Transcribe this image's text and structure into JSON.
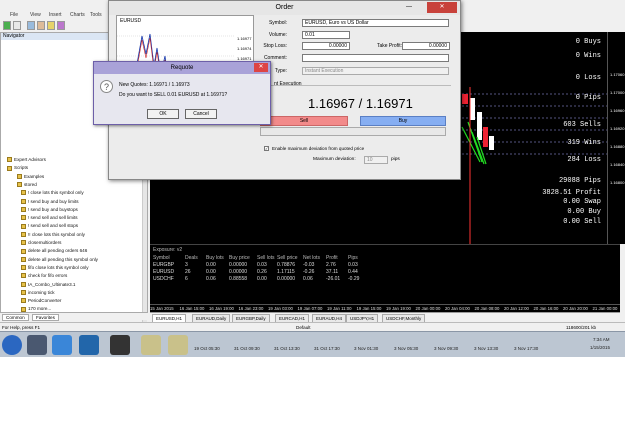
{
  "menu": {
    "items": [
      "File",
      "View",
      "Insert",
      "Charts",
      "Tools"
    ]
  },
  "navigator": {
    "title": "Navigator",
    "items": [
      {
        "label": "Expert Advisors"
      },
      {
        "label": "Scripts"
      },
      {
        "label": "Examples"
      },
      {
        "label": "stored"
      },
      {
        "label": "! close lots this symbol only"
      },
      {
        "label": "! send buy and buy limits"
      },
      {
        "label": "! send buy and buystops"
      },
      {
        "label": "! send sell and sell limits"
      },
      {
        "label": "! send sell and sell stops"
      },
      {
        "label": "!! close lots this symbol only"
      },
      {
        "label": "closemultiorders"
      },
      {
        "label": "delete all pending orders 646"
      },
      {
        "label": "delete all pending this symbol only"
      },
      {
        "label": "fifo close lots this symbol only"
      },
      {
        "label": "check for fifo errors"
      },
      {
        "label": "IA_Combo_Ultimate3.1"
      },
      {
        "label": "incoming tick"
      },
      {
        "label": "PeriodConverter"
      },
      {
        "label": "170 more..."
      }
    ],
    "tabs": [
      "Common",
      "Favorites"
    ]
  },
  "order_dialog": {
    "title": "Order",
    "symbol_label": "Symbol:",
    "symbol_value": "EURUSD, Euro vs US Dollar",
    "volume_label": "Volume:",
    "volume_value": "0.01",
    "stoploss_label": "Stop Loss:",
    "stoploss_value": "0.00000",
    "takeprofit_label": "Take Profit:",
    "takeprofit_value": "0.00000",
    "comment_label": "Comment:",
    "comment_value": "",
    "type_label": "Type:",
    "type_value": "Instant Execution",
    "section_label": "nt Execution",
    "quotes_bid": "1.16967",
    "quotes_sep": " / ",
    "quotes_ask": "1.16971",
    "sell_label": "Sell",
    "buy_label": "Buy",
    "deviation_check_label": "Enable maximum deviation from quoted price",
    "deviation_label": "Maximum deviation:",
    "deviation_value": "10",
    "deviation_unit": "pips",
    "minichart": {
      "symbol": "EURUSD",
      "prices": [
        "1.16977",
        "1.16974",
        "1.16971",
        "1.16967",
        "1.16954",
        "1.16951",
        "1.16948"
      ]
    }
  },
  "requote": {
    "title": "Requote",
    "line1": "New Quotes: 1.16971 / 1.16973",
    "line2": "Do you want to SELL 0.01 EURUSD at 1.16971?",
    "ok_label": "OK",
    "cancel_label": "Cancel"
  },
  "chart": {
    "stats": [
      {
        "text": "0  Buys"
      },
      {
        "text": "0  Wins"
      },
      {
        "text": "0  Loss"
      },
      {
        "text": "0  Pips"
      },
      {
        "text": "603 Sells"
      },
      {
        "text": "319 Wins"
      },
      {
        "text": "284 Loss"
      },
      {
        "text": "29088 Pips"
      },
      {
        "text": "3828.51  Profit"
      },
      {
        "text": "0.00  Swap"
      },
      {
        "text": "0.00  Buy"
      },
      {
        "text": "0.00  Sell"
      }
    ],
    "price_ticks": [
      "1.17060",
      "1.17000",
      "1.16960",
      "1.16920",
      "1.16880",
      "1.16840",
      "1.16800"
    ]
  },
  "terminal": {
    "header": "Exposure: v2",
    "columns": [
      "Symbol",
      "Deals",
      "Buy lots",
      "Buy price",
      "Sell lots",
      "Sell price",
      "Net lots",
      "Profit",
      "Pips"
    ],
    "rows": [
      [
        "EURGBP",
        "3",
        "0.00",
        "0.00000",
        "0.03",
        "0.78876",
        "-0.03",
        "2.76",
        "0.03"
      ],
      [
        "EURUSD",
        "26",
        "0.00",
        "0.00000",
        "0.26",
        "1.17115",
        "-0.26",
        "37.11",
        "0.44"
      ],
      [
        "USDCHF",
        "6",
        "0.06",
        "0.88558",
        "0.00",
        "0.00000",
        "0.06",
        "-26.01",
        "-0.29"
      ]
    ]
  },
  "timeline": [
    "15 Jan 2015",
    "16 Jan 15:00",
    "16 Jan 19:00",
    "16 Jan 23:00",
    "19 Jan 03:00",
    "19 Jan 07:00",
    "19 Jan 11:00",
    "19 Jan 15:00",
    "19 Jan 19:00",
    "20 Jan 00:00",
    "20 Jan 04:00",
    "20 Jan 08:00",
    "20 Jan 12:00",
    "20 Jan 16:00",
    "20 Jan 20:00",
    "21 Jan 00:00"
  ],
  "chart_tabs": [
    "EURUSD,H1",
    "EURAUD,Daily",
    "EURGBP,Daily",
    "EURCAD,H1",
    "EURAUD,H4",
    "USDJPY,H1",
    "USDCHF,Monthly"
  ],
  "status": {
    "help": "For Help, press F1",
    "profile": "Default",
    "connection": "118600/201 kb"
  },
  "taskbar": {
    "time": "7:34 AM",
    "date": "1/15/2015",
    "ticker": [
      "19 Oct 05:30",
      "31 Oct 09:30",
      "31 Oct 13:30",
      "31 Oct 17:30",
      "3 Nov 01:30",
      "3 Nov 05:30",
      "3 Nov 09:30",
      "3 Nov 13:30",
      "3 Nov 17:30"
    ]
  },
  "colors": {
    "chart_bg": "#000000",
    "chart_text": "#ffffff",
    "sell_button": "#f28a8a",
    "buy_button": "#86aef2",
    "requote_title": "#a9a2d8"
  }
}
